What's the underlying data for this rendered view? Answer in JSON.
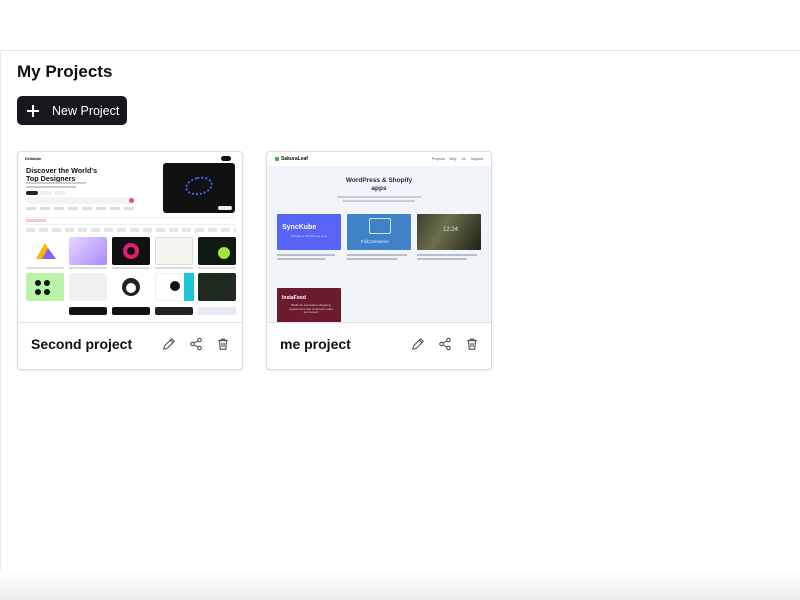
{
  "page": {
    "title": "My Projects",
    "new_project_label": "New Project"
  },
  "projects": [
    {
      "name": "Second project",
      "thumbnail": {
        "logo": "Dribbble",
        "headline": "Discover the World's Top Designers"
      }
    },
    {
      "name": "me project",
      "thumbnail": {
        "logo": "SakuraLeaf",
        "nav_links": "Projects Why Us Support",
        "headline": "WordPress & Shopify apps",
        "cards": [
          {
            "name": "SyncKube",
            "sub": "Shopify to WordPress sync"
          },
          {
            "name": "FillCommerce"
          },
          {
            "name": "12:24"
          },
          {
            "name": "InstaFood",
            "sub": "Build the innovative shopping experiences that customers want and expect"
          }
        ]
      }
    }
  ],
  "icons": {
    "add": "plus-icon",
    "edit": "pencil-icon",
    "share": "share-icon",
    "delete": "trash-icon"
  },
  "colors": {
    "button_bg": "#17181b",
    "card_border": "#dcdcdc"
  }
}
